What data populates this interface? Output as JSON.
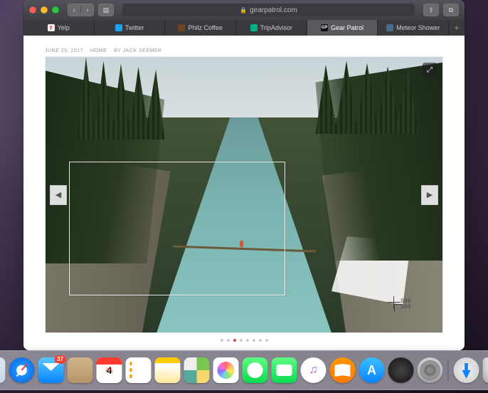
{
  "toolbar": {
    "address": "gearpatrol.com"
  },
  "tabs": [
    {
      "label": "Yelp",
      "fav": "yelp",
      "active": false
    },
    {
      "label": "Twitter",
      "fav": "tw",
      "active": false
    },
    {
      "label": "Philz Coffee",
      "fav": "philz",
      "active": false
    },
    {
      "label": "TripAdvisor",
      "fav": "trip",
      "active": false
    },
    {
      "label": "Gear Patrol",
      "fav": "gp",
      "active": true
    },
    {
      "label": "Meteor Shower",
      "fav": "ms",
      "active": false
    }
  ],
  "article": {
    "date": "JUNE 29, 2017",
    "category": "HOME",
    "byline": "By JACK SEEMER"
  },
  "crosshair": {
    "x": "509",
    "y": "309"
  },
  "calendar": {
    "month": "JUL",
    "day": "4"
  },
  "mail_badge": "37",
  "dock_apps": [
    "finder",
    "safari",
    "mail",
    "contacts",
    "cal",
    "reminders",
    "notes",
    "maps",
    "photos",
    "messages",
    "facetime",
    "itunes",
    "ibooks",
    "appstore",
    "dark",
    "sysprefs"
  ]
}
